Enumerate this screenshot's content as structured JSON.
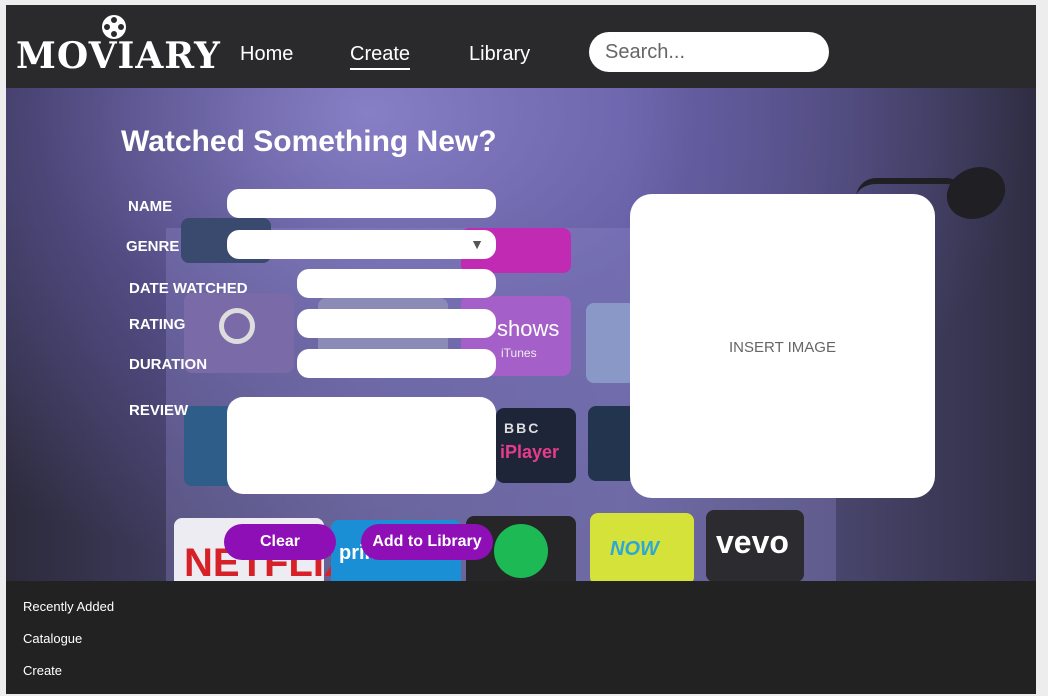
{
  "brand": {
    "logo_text": "MOVIARY"
  },
  "nav": {
    "items": [
      {
        "label": "Home"
      },
      {
        "label": "Create"
      },
      {
        "label": "Library"
      }
    ]
  },
  "search": {
    "placeholder": "Search..."
  },
  "form": {
    "heading": "Watched Something New?",
    "fields": {
      "name": {
        "label": "NAME",
        "value": ""
      },
      "genre": {
        "label": "GENRE",
        "value": ""
      },
      "date_watched": {
        "label": "DATE WATCHED",
        "value": ""
      },
      "rating": {
        "label": "RATING",
        "value": ""
      },
      "duration": {
        "label": "DURATION",
        "value": ""
      },
      "review": {
        "label": "REVIEW",
        "value": ""
      }
    },
    "image_placeholder": "INSERT IMAGE",
    "clear_label": "Clear",
    "add_label": "Add to Library"
  },
  "background_tiles": {
    "shows": "shows",
    "itunes": "iTunes",
    "bbc": "BBC",
    "iplayer": "iPlayer",
    "netflix": "NETFLIX",
    "prime": "prime",
    "now": "NOW",
    "vevo": "vevo"
  },
  "footer": {
    "links": [
      {
        "label": "Recently Added"
      },
      {
        "label": "Catalogue"
      },
      {
        "label": "Create"
      }
    ]
  },
  "colors": {
    "accent": "#8e0fb6",
    "header_bg": "#2a2a2d",
    "footer_bg": "#222222"
  }
}
